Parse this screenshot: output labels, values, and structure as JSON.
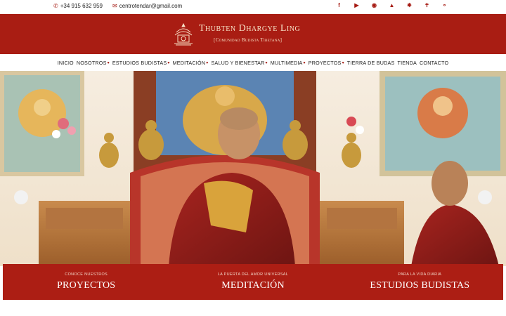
{
  "topbar": {
    "phone": "+34 915 632 959",
    "email": "centrotendar@gmail.com",
    "social_icons": [
      "facebook-icon",
      "youtube-icon",
      "instagram-icon",
      "stupa-icon",
      "dharma-wheel-icon",
      "vajra-icon",
      "bell-icon"
    ]
  },
  "header": {
    "title": "Thubten Dhargye Ling",
    "subtitle": "[Comunidad Budista Tibetana]"
  },
  "nav": {
    "items": [
      {
        "label": "Inicio",
        "dropdown": false
      },
      {
        "label": "Nosotros",
        "dropdown": true
      },
      {
        "label": "Estudios Budistas",
        "dropdown": true
      },
      {
        "label": "Meditación",
        "dropdown": true
      },
      {
        "label": "Salud y Bienestar",
        "dropdown": true
      },
      {
        "label": "Multimedia",
        "dropdown": true
      },
      {
        "label": "Proyectos",
        "dropdown": true
      },
      {
        "label": "Tierra de Budas",
        "dropdown": false
      },
      {
        "label": "Tienda",
        "dropdown": false
      },
      {
        "label": "Contacto",
        "dropdown": false
      }
    ]
  },
  "cta": [
    {
      "kicker": "CONOCE NUESTROS",
      "heading": "PROYECTOS"
    },
    {
      "kicker": "LA PUERTA DEL AMOR UNIVERSAL",
      "heading": "MEDITACIÓN"
    },
    {
      "kicker": "PARA LA VIDA DIARIA",
      "heading": "ESTUDIOS BUDISTAS"
    }
  ],
  "colors": {
    "brand_red": "#a91d13",
    "cream": "#f7e1c6"
  }
}
